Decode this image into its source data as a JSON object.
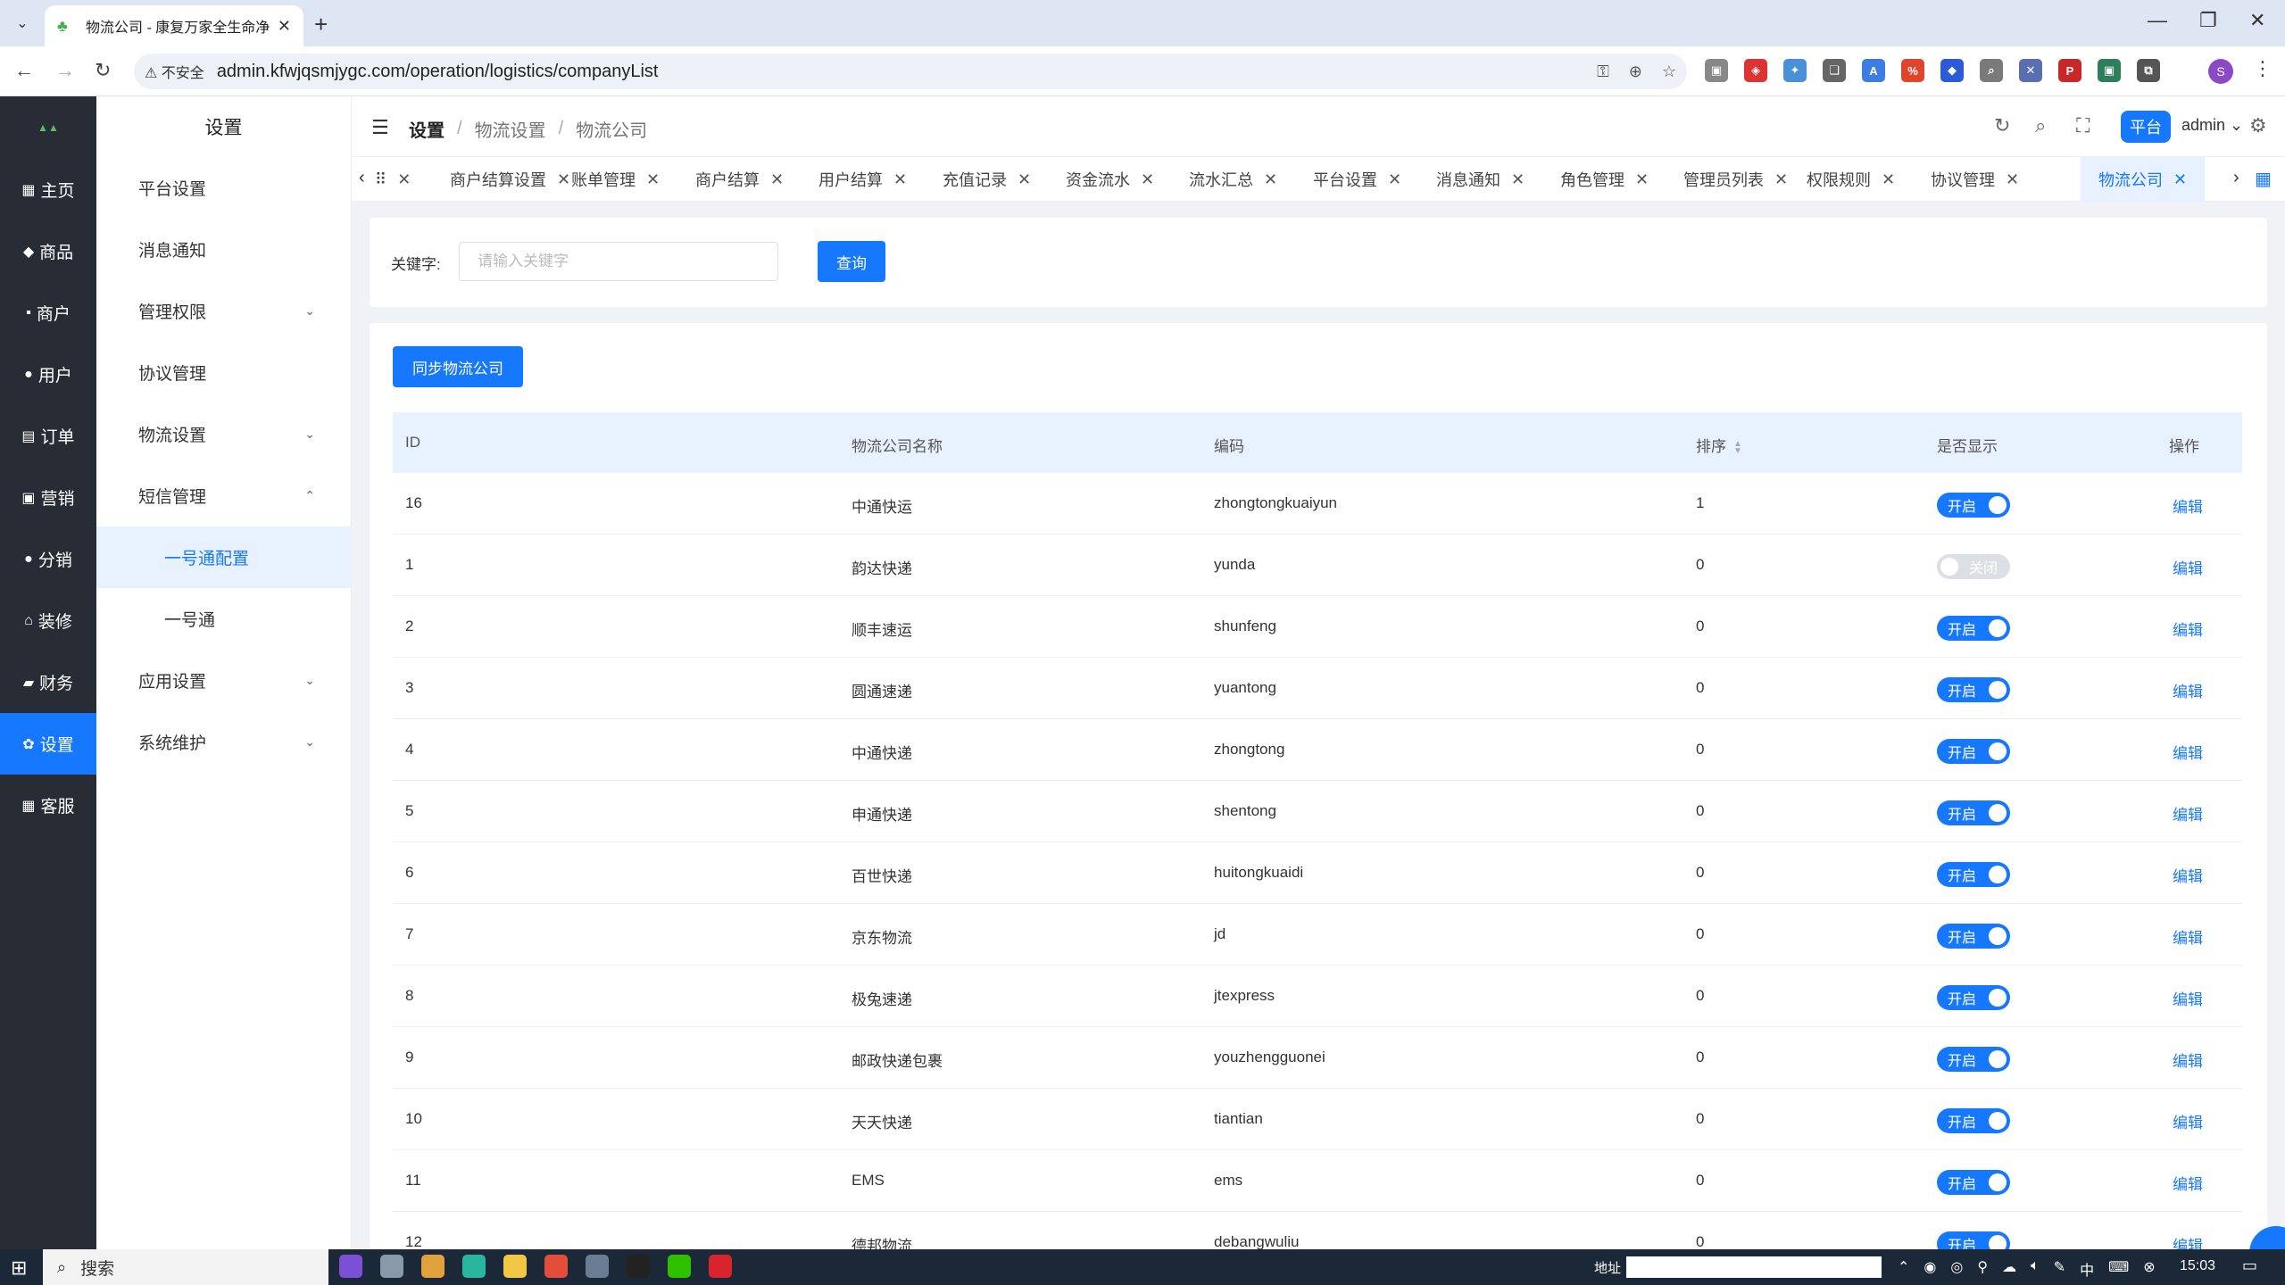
{
  "browser": {
    "tab_title": "物流公司 - 康复万家全生命净化",
    "security_label": "不安全",
    "url": "admin.kfwjqsmjygc.com/operation/logistics/companyList"
  },
  "leftnav": {
    "items": [
      {
        "icon": "grid-icon",
        "glyph": "▦",
        "label": "主页"
      },
      {
        "icon": "bag-icon",
        "glyph": "◆",
        "label": "商品"
      },
      {
        "icon": "shop-icon",
        "glyph": "▪",
        "label": "商户"
      },
      {
        "icon": "user-icon",
        "glyph": "●",
        "label": "用户"
      },
      {
        "icon": "order-icon",
        "glyph": "▤",
        "label": "订单"
      },
      {
        "icon": "marketing-icon",
        "glyph": "▣",
        "label": "营销"
      },
      {
        "icon": "share-icon",
        "glyph": "●",
        "label": "分销"
      },
      {
        "icon": "decorate-icon",
        "glyph": "⌂",
        "label": "装修"
      },
      {
        "icon": "finance-icon",
        "glyph": "▰",
        "label": "财务"
      },
      {
        "icon": "gear-icon",
        "glyph": "✿",
        "label": "设置"
      },
      {
        "icon": "service-icon",
        "glyph": "▦",
        "label": "客服"
      }
    ]
  },
  "submenu": {
    "title": "设置",
    "items": [
      {
        "label": "平台设置",
        "chevron": ""
      },
      {
        "label": "消息通知",
        "chevron": ""
      },
      {
        "label": "管理权限",
        "chevron": "⌄"
      },
      {
        "label": "协议管理",
        "chevron": ""
      },
      {
        "label": "物流设置",
        "chevron": "⌄"
      },
      {
        "label": "短信管理",
        "chevron": "⌃"
      },
      {
        "label": "一号通配置",
        "chevron": ""
      },
      {
        "label": "一号通",
        "chevron": ""
      },
      {
        "label": "应用设置",
        "chevron": "⌄"
      },
      {
        "label": "系统维护",
        "chevron": "⌄"
      }
    ]
  },
  "header": {
    "breadcrumb": [
      "设置",
      "物流设置",
      "物流公司"
    ],
    "separator": "/",
    "platform_label": "平台",
    "user": "admin"
  },
  "pagetabs": {
    "items": [
      "商户结算设置",
      "账单管理",
      "商户结算",
      "用户结算",
      "充值记录",
      "资金流水",
      "流水汇总",
      "平台设置",
      "消息通知",
      "角色管理",
      "管理员列表",
      "权限规则",
      "协议管理"
    ],
    "active": "物流公司"
  },
  "search": {
    "label": "关键字:",
    "placeholder": "请输入关键字",
    "button": "查询"
  },
  "table": {
    "sync_button": "同步物流公司",
    "columns": [
      "ID",
      "物流公司名称",
      "编码",
      "排序",
      "是否显示",
      "操作"
    ],
    "on_label": "开启",
    "off_label": "关闭",
    "edit_label": "编辑",
    "rows": [
      {
        "id": "16",
        "name": "中通快运",
        "code": "zhongtongkuaiyun",
        "sort": "1",
        "show": true
      },
      {
        "id": "1",
        "name": "韵达快递",
        "code": "yunda",
        "sort": "0",
        "show": false
      },
      {
        "id": "2",
        "name": "顺丰速运",
        "code": "shunfeng",
        "sort": "0",
        "show": true
      },
      {
        "id": "3",
        "name": "圆通速递",
        "code": "yuantong",
        "sort": "0",
        "show": true
      },
      {
        "id": "4",
        "name": "中通快递",
        "code": "zhongtong",
        "sort": "0",
        "show": true
      },
      {
        "id": "5",
        "name": "申通快递",
        "code": "shentong",
        "sort": "0",
        "show": true
      },
      {
        "id": "6",
        "name": "百世快递",
        "code": "huitongkuaidi",
        "sort": "0",
        "show": true
      },
      {
        "id": "7",
        "name": "京东物流",
        "code": "jd",
        "sort": "0",
        "show": true
      },
      {
        "id": "8",
        "name": "极兔速递",
        "code": "jtexpress",
        "sort": "0",
        "show": true
      },
      {
        "id": "9",
        "name": "邮政快递包裹",
        "code": "youzhengguonei",
        "sort": "0",
        "show": true
      },
      {
        "id": "10",
        "name": "天天快递",
        "code": "tiantian",
        "sort": "0",
        "show": true
      },
      {
        "id": "11",
        "name": "EMS",
        "code": "ems",
        "sort": "0",
        "show": true
      },
      {
        "id": "12",
        "name": "德邦物流",
        "code": "debangwuliu",
        "sort": "0",
        "show": true
      }
    ]
  },
  "taskbar": {
    "search_label": "搜索",
    "address_label": "地址",
    "ime": "中",
    "time": "15:03"
  }
}
